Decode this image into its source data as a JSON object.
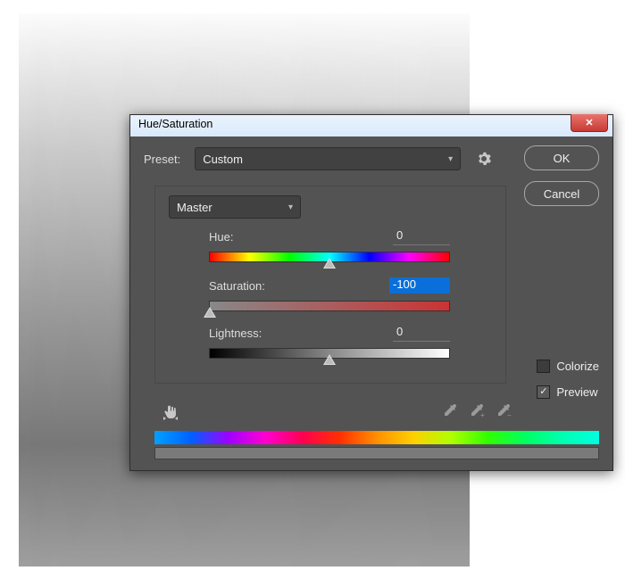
{
  "dialog": {
    "title": "Hue/Saturation",
    "preset_label": "Preset:",
    "preset_value": "Custom",
    "channel_value": "Master",
    "ok": "OK",
    "cancel": "Cancel",
    "hue": {
      "label": "Hue:",
      "value": "0",
      "pos": 50
    },
    "sat": {
      "label": "Saturation:",
      "value": "-100",
      "pos": 0
    },
    "lgt": {
      "label": "Lightness:",
      "value": "0",
      "pos": 50
    },
    "colorize": "Colorize",
    "preview": "Preview",
    "icons": {
      "gear": "settings-icon",
      "hand": "target-adjust-icon",
      "eyedropper": "eyedropper-icon",
      "eyedropper_plus": "eyedropper-plus-icon",
      "eyedropper_minus": "eyedropper-minus-icon",
      "close": "close-icon",
      "chevron": "chevron-down-icon"
    }
  }
}
